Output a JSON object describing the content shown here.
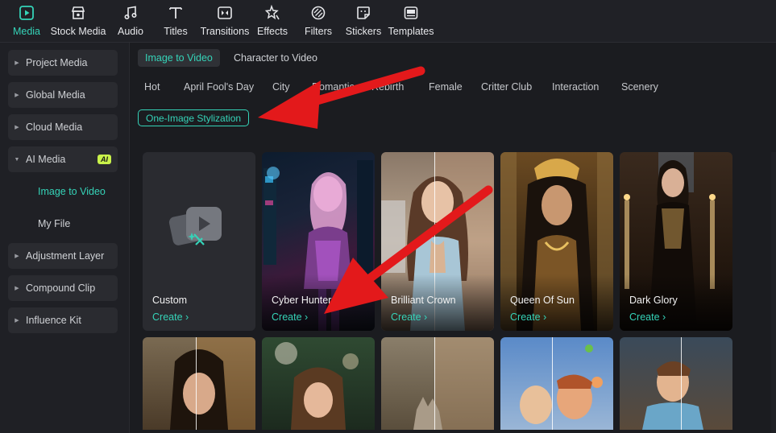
{
  "toolbar": {
    "items": [
      {
        "label": "Media",
        "icon": "media-icon",
        "active": true
      },
      {
        "label": "Stock Media",
        "icon": "stock-media-icon"
      },
      {
        "label": "Audio",
        "icon": "music-note-icon"
      },
      {
        "label": "Titles",
        "icon": "text-t-icon"
      },
      {
        "label": "Transitions",
        "icon": "transitions-icon"
      },
      {
        "label": "Effects",
        "icon": "effects-icon"
      },
      {
        "label": "Filters",
        "icon": "filters-icon"
      },
      {
        "label": "Stickers",
        "icon": "stickers-icon"
      },
      {
        "label": "Templates",
        "icon": "templates-icon"
      }
    ]
  },
  "sidebar": {
    "items": [
      {
        "label": "Project Media"
      },
      {
        "label": "Global Media"
      },
      {
        "label": "Cloud Media"
      },
      {
        "label": "AI Media",
        "badge": "AI",
        "open": true
      },
      {
        "label": "Adjustment Layer"
      },
      {
        "label": "Compound Clip"
      },
      {
        "label": "Influence Kit"
      }
    ],
    "sub": [
      {
        "label": "Image to Video",
        "active": true
      },
      {
        "label": "My File"
      }
    ]
  },
  "main": {
    "tabs": [
      {
        "label": "Image to Video",
        "active": true
      },
      {
        "label": "Character to Video"
      }
    ],
    "categories": [
      "Hot",
      "April Fool's Day",
      "City",
      "Romantic",
      "Rebirth",
      "Female",
      "Critter Club",
      "Interaction",
      "Scenery"
    ],
    "pill": "One-Image Stylization",
    "cards": [
      {
        "title": "Custom",
        "create": "Create ›"
      },
      {
        "title": "Cyber Hunter",
        "create": "Create ›"
      },
      {
        "title": "Brilliant Crown",
        "create": "Create ›"
      },
      {
        "title": "Queen Of Sun",
        "create": "Create ›"
      },
      {
        "title": "Dark Glory",
        "create": "Create ›"
      }
    ]
  },
  "colors": {
    "accent": "#35d3b8",
    "annotation": "#e3191b",
    "ai_badge": "#c9f24a"
  }
}
